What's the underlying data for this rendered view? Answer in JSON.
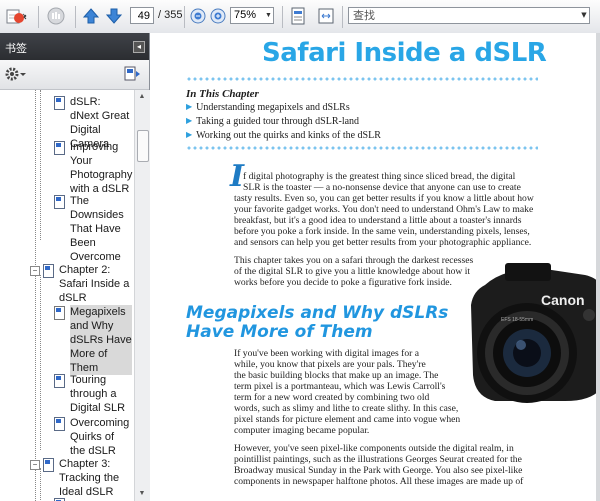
{
  "toolbar": {
    "page_current": "49",
    "page_total": "/ 355",
    "zoom": "75%",
    "find_placeholder": "查找",
    "icons": [
      "open-file-icon",
      "hand-tool-icon",
      "prev-page-icon",
      "next-page-icon",
      "zoom-out-icon",
      "zoom-in-icon",
      "single-page-icon",
      "fit-width-icon"
    ]
  },
  "sidebar": {
    "title": "书签",
    "items": [
      {
        "label": "dSLR: dNext Great Digital Camera"
      },
      {
        "label": "Improving Your Photography with a dSLR"
      },
      {
        "label": "The Downsides That Have Been Overcome"
      },
      {
        "label": "Chapter 2: Safari Inside a dSLR"
      },
      {
        "label": "Megapixels and Why dSLRs Have More of Them"
      },
      {
        "label": "Touring through a Digital SLR"
      },
      {
        "label": "Overcoming Quirks of the dSLR"
      },
      {
        "label": "Chapter 3: Tracking the Ideal dSLR"
      }
    ]
  },
  "document": {
    "chapter_title": "Safari Inside a dSLR",
    "in_this_chapter": "In This Chapter",
    "bullets": [
      "Understanding megapixels and dSLRs",
      "Taking a guided tour through dSLR-land",
      "Working out the quirks and kinks of the dSLR"
    ],
    "dropcap": "I",
    "intro_lines": [
      "f digital photography is the greatest thing since sliced bread, the digital",
      "SLR is the toaster — a no-nonsense device that anyone can use to create",
      "tasty results. Even so, you can get better results if you know a little about how",
      "your favorite gadget works. You don't need to understand Ohm's Law to make",
      "breakfast, but it's a good idea to understand a little about a toaster's innards",
      "before you poke a fork inside. In the same vein, understanding pixels, lenses,",
      "and sensors can help you get better results from your photographic appliance."
    ],
    "para2_lines": [
      "This chapter takes you on a safari through the darkest recesses",
      "of the digital SLR to give you a little knowledge about how it",
      "works before you decide to poke a figurative fork inside."
    ],
    "section_heading_1": "Megapixels and Why dSLRs",
    "section_heading_2": "Have More of Them",
    "para3_lines": [
      "If you've been working with digital images for a",
      "while, you know that pixels are your pals. They're",
      "the basic building blocks that make up an image. The",
      "term pixel is a portmanteau, which was Lewis Carroll's",
      "term for a new word created by combining two old",
      "words, such as slimy and lithe to create slithy. In this case,",
      "pixel stands for picture element and came into vogue when",
      "computer imaging became popular."
    ],
    "para4_lines": [
      "However, you've seen pixel-like components outside the digital realm, in",
      "pointillist paintings, such as the illustrations Georges Seurat created for the",
      "Broadway musical Sunday in the Park with George. You also see pixel-like",
      "components in newspaper halftone photos. All these images are made up of"
    ],
    "camera_brand": "Canon",
    "lens_text": "EFS 18-55mm"
  }
}
